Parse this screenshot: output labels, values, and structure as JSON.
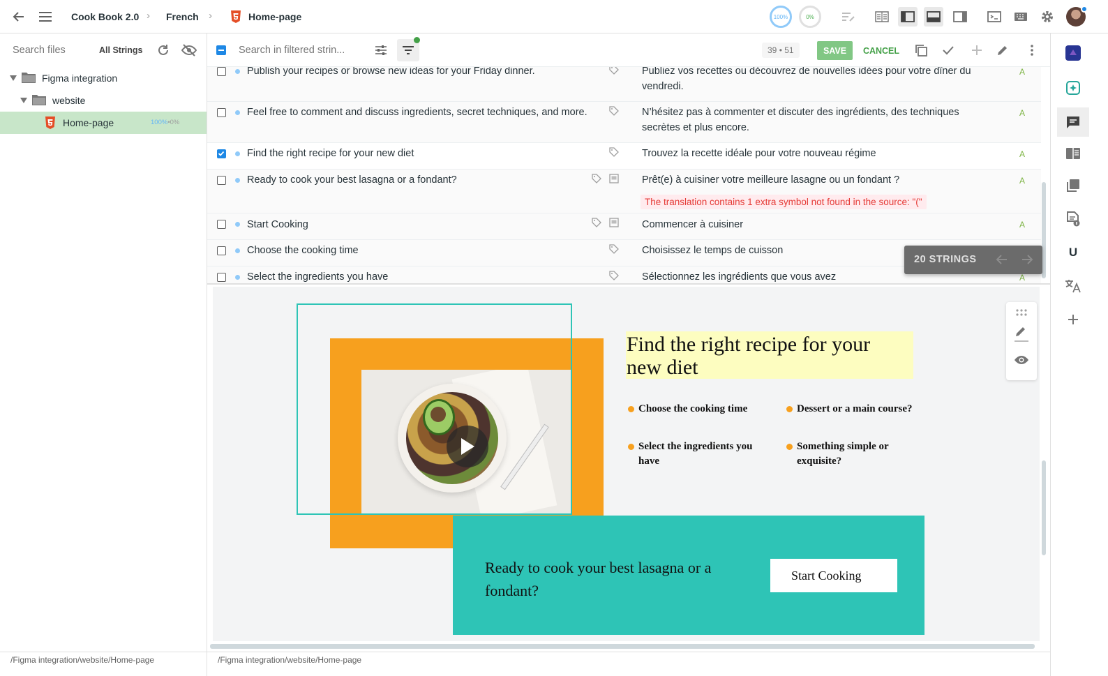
{
  "header": {
    "project": "Cook Book 2.0",
    "language": "French",
    "file": "Home-page",
    "progress_translated": "100%",
    "progress_approved": "0%"
  },
  "sidebar": {
    "search_placeholder": "Search files",
    "filter_label": "All Strings",
    "tree": [
      {
        "label": "Figma integration",
        "type": "folder"
      },
      {
        "label": "website",
        "type": "folder"
      },
      {
        "label": "Home-page",
        "type": "file",
        "stats_a": "100%",
        "stats_sep": "•",
        "stats_b": "0%"
      }
    ],
    "path": "/Figma integration/website/Home-page"
  },
  "toolbar": {
    "search_placeholder": "Search in filtered strin...",
    "count_a": "39",
    "count_sep": "•",
    "count_b": "51",
    "save_label": "SAVE",
    "cancel_label": "CANCEL"
  },
  "strings": [
    {
      "source": "Publish your recipes or browse new ideas for your Friday dinner.",
      "target": "Publiez vos recettes ou découvrez de nouvelles idées pour votre dîner du vendredi.",
      "checked": false
    },
    {
      "source": "Feel free to comment and discuss ingredients, secret techniques, and more.",
      "target": "N’hésitez pas à commenter et discuter des ingrédients, des techniques secrètes et plus encore.",
      "checked": false
    },
    {
      "source": "Find the right recipe for your new diet",
      "target": "Trouvez la recette idéale pour votre nouveau régime",
      "checked": true
    },
    {
      "source": "Ready to cook your best lasagna or a fondant?",
      "target": "Prêt(e) à cuisiner votre meilleure lasagne ou un fondant ?",
      "checked": false,
      "warning": "The translation contains 1 extra symbol not found in the source: \"(\""
    },
    {
      "source": "Start Cooking",
      "target": "Commencer à cuisiner",
      "checked": false
    },
    {
      "source": "Choose the cooking time",
      "target": "Choisissez le temps de cuisson",
      "checked": false
    },
    {
      "source": "Select the ingredients you have",
      "target": "Sélectionnez les ingrédients que vous avez",
      "checked": false
    }
  ],
  "strings_nav": {
    "label": "20 STRINGS"
  },
  "preview": {
    "heading": "Find the right recipe for your new diet",
    "bullets": [
      "Choose the cooking time",
      "Dessert or a main course?",
      "Select the ingredients you have",
      "Something simple or exquisite?"
    ],
    "cta_text": "Ready to cook your best lasagna or a fondant?",
    "cta_button": "Start Cooking",
    "colors": {
      "orange": "#f7a01e",
      "teal": "#2ec4b6",
      "highlight": "#fdfdc0"
    }
  },
  "status": {
    "path": "/Figma integration/website/Home-page"
  }
}
